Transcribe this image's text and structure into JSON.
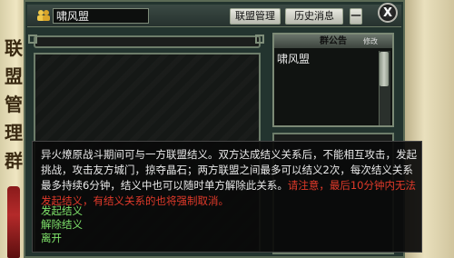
{
  "side_banner": {
    "chars": [
      "联",
      "盟",
      "管",
      "理",
      "群"
    ]
  },
  "header": {
    "alliance_name": "啸风盟",
    "buttons": {
      "manage": "联盟管理",
      "history": "历史消息",
      "minimize": "一",
      "close": "X"
    }
  },
  "notice": {
    "title": "群公告",
    "edit_label": "修改",
    "content": "啸风盟"
  },
  "tooltip": {
    "main": "异火燎原战斗期间可与一方联盟结义。双方达成结义关系后，不能相互攻击，发起挑战，攻击友方城门，掠夺晶石；两方联盟之间最多可以结义2次，每次结义关系最多持续6分钟，结义中也可以随时单方解除此关系。",
    "warning": "请注意，最后10分钟内无法发起结义，有结义关系的也将强制取消。",
    "links": [
      "发起结义",
      "解除结义",
      "离开"
    ]
  },
  "colors": {
    "warning": "#e23a2a",
    "link": "#7fe36a",
    "text": "#eaeaea"
  },
  "icons": {
    "alliance": "two-people-icon",
    "close": "close-icon"
  }
}
